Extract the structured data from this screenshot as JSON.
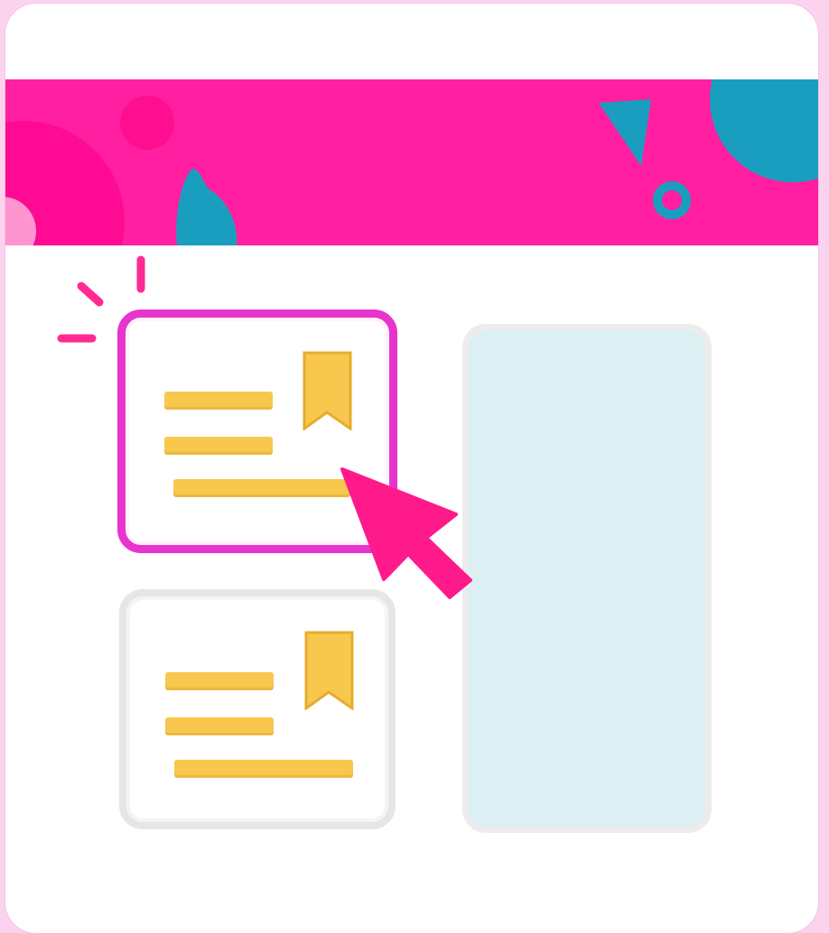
{
  "window": {
    "background": "#ffffff",
    "frame_color": "#fbd3ef"
  },
  "header_banner": {
    "color": "#ff1fa0",
    "accent_color": "#1a9ec0",
    "decorations": [
      "circle-shape",
      "leaf-shape",
      "droplet-shape",
      "ring-shape",
      "blob-shape"
    ]
  },
  "cards": [
    {
      "state": "selected",
      "border_color": "#e734cf",
      "icon": "bookmark-icon",
      "text_line_count": 3,
      "line_color": "#f8c74e"
    },
    {
      "state": "default",
      "border_color": "#e6e6e6",
      "icon": "bookmark-icon",
      "text_line_count": 3,
      "line_color": "#f8c74e"
    }
  ],
  "preview_panel": {
    "color": "#dcf0f3"
  },
  "cursor": {
    "icon": "arrow-cursor-icon",
    "color": "#ff1a8c"
  },
  "highlight": {
    "icon": "sparkle-lines-icon",
    "color": "#ff2a93"
  }
}
